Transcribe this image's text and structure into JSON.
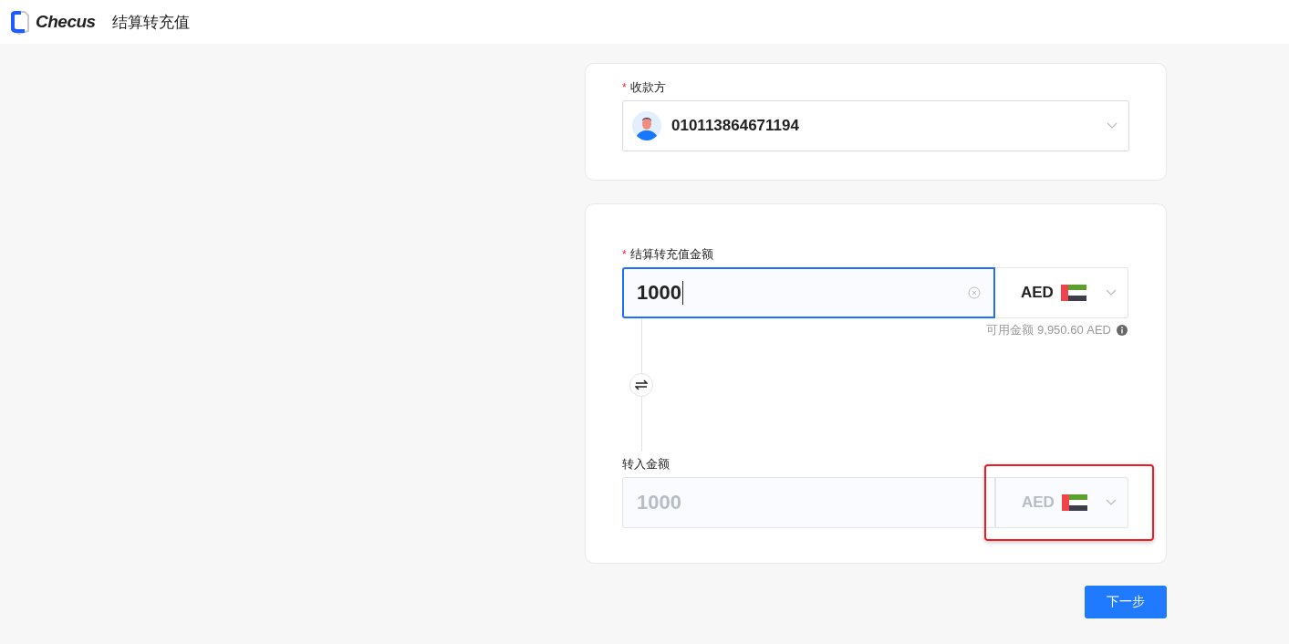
{
  "header": {
    "brand": "Checus",
    "title": "结算转充值"
  },
  "payee": {
    "required_mark": "*",
    "label": "收款方",
    "value": "010113864671194"
  },
  "amount": {
    "required_mark": "*",
    "label": "结算转充值金额",
    "value": "1000",
    "focused": true,
    "currency": "AED",
    "hint": "可用金额 9,950.60 AED"
  },
  "incoming": {
    "label": "转入金额",
    "value": "1000",
    "disabled": true,
    "currency": "AED",
    "highlighted": true
  },
  "next_button": "下一步"
}
